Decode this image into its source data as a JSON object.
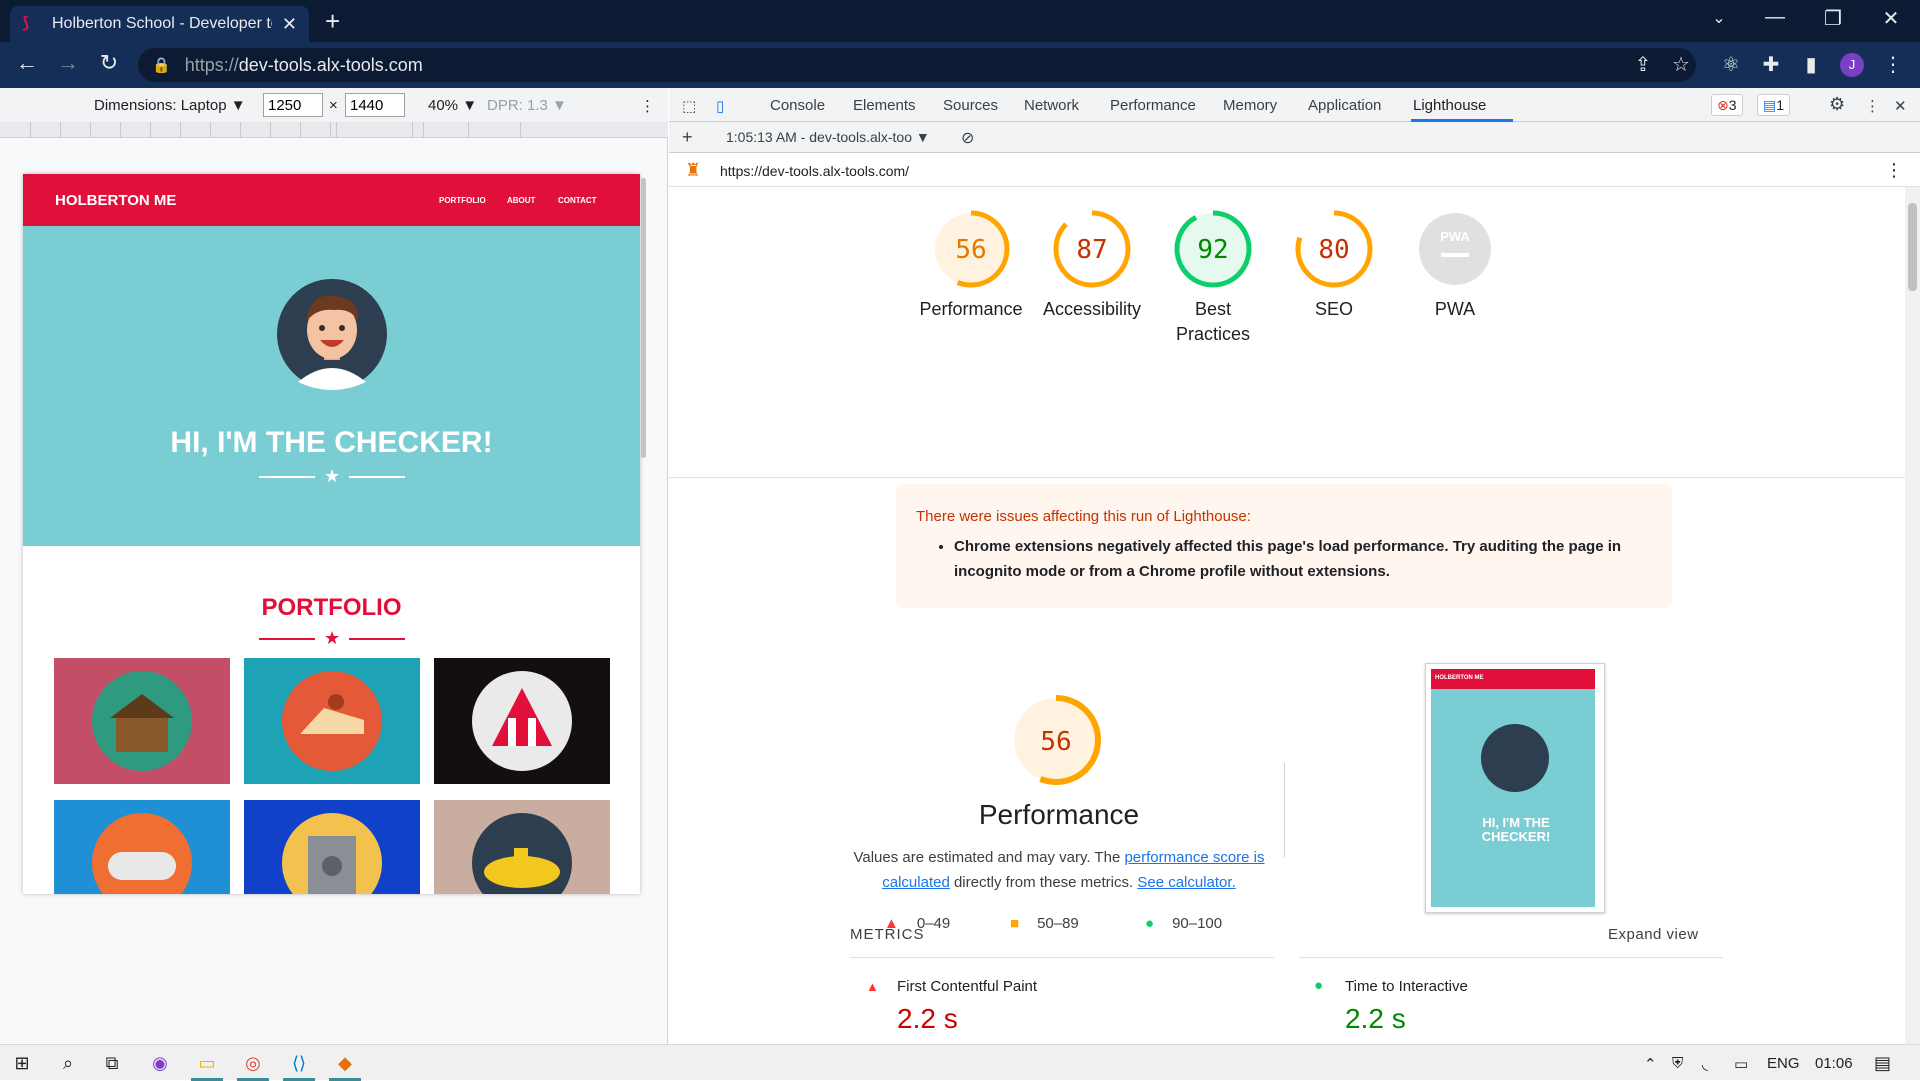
{
  "browser": {
    "tab_title": "Holberton School - Developer tools",
    "url_scheme": "https://",
    "url_host": "dev-tools.alx-tools.com",
    "avatar_letter": "J"
  },
  "device_toolbar": {
    "dimensions_label": "Dimensions: Laptop ▼",
    "width": "1250",
    "times": "×",
    "height": "1440",
    "zoom": "40% ▼",
    "dpr": "DPR: 1.3 ▼"
  },
  "site": {
    "logo": "HOLBERTON ME",
    "nav": [
      "PORTFOLIO",
      "ABOUT",
      "CONTACT"
    ],
    "hero_title": "HI, I'M THE CHECKER!",
    "portfolio_title": "PORTFOLIO",
    "tile_colors": [
      "#c44d67",
      "#1ea3b6",
      "#140f0f",
      "#1f8fd6",
      "#1241c9",
      "#c8ada0"
    ]
  },
  "devtools": {
    "tabs": [
      "Console",
      "Elements",
      "Sources",
      "Network",
      "Performance",
      "Memory",
      "Application",
      "Lighthouse"
    ],
    "active_tab": "Lighthouse",
    "error_count": "3",
    "message_count": "1",
    "run_label": "1:05:13 AM - dev-tools.alx-too ▼",
    "report_url": "https://dev-tools.alx-tools.com/"
  },
  "scores": [
    {
      "score": "56",
      "label": "Performance",
      "value": 56,
      "color": "#e67700",
      "ring": "#ffa400",
      "bg": "#fff3e0"
    },
    {
      "score": "87",
      "label": "Accessibility",
      "value": 87,
      "color": "#c33300",
      "ring": "#ffa400",
      "bg": "#fff"
    },
    {
      "score": "92",
      "label": "Best Practices",
      "value": 92,
      "color": "#008800",
      "ring": "#0cce6b",
      "bg": "#e6f9ee"
    },
    {
      "score": "80",
      "label": "SEO",
      "value": 80,
      "color": "#c33300",
      "ring": "#ffa400",
      "bg": "#fff"
    },
    {
      "score": "PWA",
      "label": "PWA",
      "value": 0,
      "color": "#ffffff",
      "ring": "#e0e0e0",
      "bg": "#e0e0e0"
    }
  ],
  "warning": {
    "heading": "There were issues affecting this run of Lighthouse:",
    "item": "Chrome extensions negatively affected this page's load performance. Try auditing the page in incognito mode or from a Chrome profile without extensions."
  },
  "performance": {
    "score": "56",
    "title": "Performance",
    "desc_before": "Values are estimated and may vary. The ",
    "link1": "performance score is calculated",
    "desc_mid": " directly from these metrics. ",
    "link2": "See calculator.",
    "legend": [
      "0–49",
      "50–89",
      "90–100"
    ],
    "thumb_logo": "HOLBERTON ME",
    "thumb_title": "HI, I'M THE CHECKER!"
  },
  "metrics": {
    "heading": "METRICS",
    "expand": "Expand view",
    "items": [
      {
        "name": "First Contentful Paint",
        "value": "2.2 s",
        "status": "fail"
      },
      {
        "name": "Time to Interactive",
        "value": "2.2 s",
        "status": "pass"
      }
    ]
  },
  "taskbar": {
    "lang": "ENG",
    "time": "01:06"
  }
}
